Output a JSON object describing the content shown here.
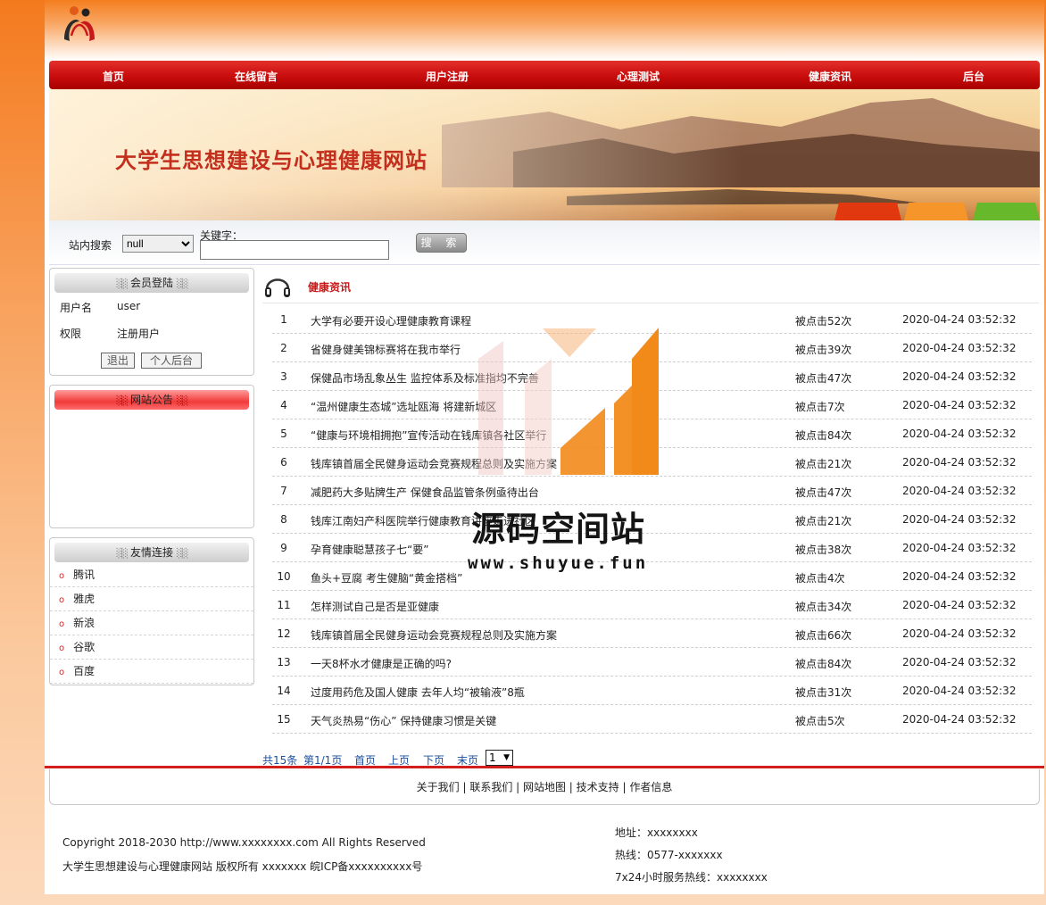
{
  "nav": [
    "首页",
    "在线留言",
    "用户注册",
    "心理测试",
    "健康资讯",
    "后台"
  ],
  "banner": {
    "title": "大学生思想建设与心理健康网站"
  },
  "search": {
    "label": "站内搜索",
    "select_value": "null",
    "keyword_label": "关键字：",
    "button": "搜 索"
  },
  "member": {
    "title": "会员登陆",
    "username_label": "用户名",
    "username": "user",
    "role_label": "权限",
    "role": "注册用户",
    "logout": "退出",
    "personal": "个人后台"
  },
  "notice": {
    "title": "网站公告"
  },
  "links": {
    "title": "友情连接",
    "items": [
      "腾讯",
      "雅虎",
      "新浪",
      "谷歌",
      "百度"
    ]
  },
  "category": {
    "title": "健康资讯"
  },
  "articles": [
    {
      "n": "1",
      "title": "大学有必要开设心理健康教育课程",
      "clicks": "被点击52次",
      "date": "2020-04-24 03:52:32"
    },
    {
      "n": "2",
      "title": "省健身健美锦标赛将在我市举行",
      "clicks": "被点击39次",
      "date": "2020-04-24 03:52:32"
    },
    {
      "n": "3",
      "title": "保健品市场乱象丛生 监控体系及标准指均不完善",
      "clicks": "被点击47次",
      "date": "2020-04-24 03:52:32"
    },
    {
      "n": "4",
      "title": "“温州健康生态城”选址瓯海 将建新城区",
      "clicks": "被点击7次",
      "date": "2020-04-24 03:52:32"
    },
    {
      "n": "5",
      "title": "“健康与环境相拥抱”宣传活动在钱库镇各社区举行",
      "clicks": "被点击84次",
      "date": "2020-04-24 03:52:32"
    },
    {
      "n": "6",
      "title": "钱库镇首届全民健身运动会竞赛规程总则及实施方案",
      "clicks": "被点击21次",
      "date": "2020-04-24 03:52:32"
    },
    {
      "n": "7",
      "title": "减肥药大多贴牌生产 保健食品监管条例亟待出台",
      "clicks": "被点击47次",
      "date": "2020-04-24 03:52:32"
    },
    {
      "n": "8",
      "title": "钱库江南妇产科医院举行健康教育讲座走进社区",
      "clicks": "被点击21次",
      "date": "2020-04-24 03:52:32"
    },
    {
      "n": "9",
      "title": "孕育健康聪慧孩子七“要”",
      "clicks": "被点击38次",
      "date": "2020-04-24 03:52:32"
    },
    {
      "n": "10",
      "title": "鱼头+豆腐 考生健脑“黄金搭档”",
      "clicks": "被点击4次",
      "date": "2020-04-24 03:52:32"
    },
    {
      "n": "11",
      "title": "怎样测试自己是否是亚健康",
      "clicks": "被点击34次",
      "date": "2020-04-24 03:52:32"
    },
    {
      "n": "12",
      "title": "钱库镇首届全民健身运动会竞赛规程总则及实施方案",
      "clicks": "被点击66次",
      "date": "2020-04-24 03:52:32"
    },
    {
      "n": "13",
      "title": "一天8杯水才健康是正确的吗?",
      "clicks": "被点击84次",
      "date": "2020-04-24 03:52:32"
    },
    {
      "n": "14",
      "title": "过度用药危及国人健康 去年人均“被输液”8瓶",
      "clicks": "被点击31次",
      "date": "2020-04-24 03:52:32"
    },
    {
      "n": "15",
      "title": "天气炎热易“伤心” 保持健康习惯是关键",
      "clicks": "被点击5次",
      "date": "2020-04-24 03:52:32"
    }
  ],
  "pager": {
    "total": "共15条",
    "page": "第1/1页",
    "first": "首页",
    "prev": "上页",
    "next": "下页",
    "last": "末页",
    "select": "1"
  },
  "footer_nav": "关于我们 | 联系我们 | 网站地图 | 技术支持 | 作者信息",
  "footer": {
    "copyright": "Copyright 2018-2030 http://www.xxxxxxxx.com All Rights Reserved",
    "icp": "大学生思想建设与心理健康网站 版权所有 xxxxxxx 皖ICP备xxxxxxxxxx号",
    "address": "地址：xxxxxxxx",
    "hotline": "热线：0577-xxxxxxx",
    "service": "7x24小时服务热线：xxxxxxxx"
  },
  "watermark": {
    "title": "源码空间站",
    "url": "www.shuyue.fun"
  },
  "colors": {
    "nav_red": "#c80d0d",
    "title_red": "#c32e1d",
    "link_blue": "#1a4ea0",
    "accent_orange": "#f47a1e"
  }
}
